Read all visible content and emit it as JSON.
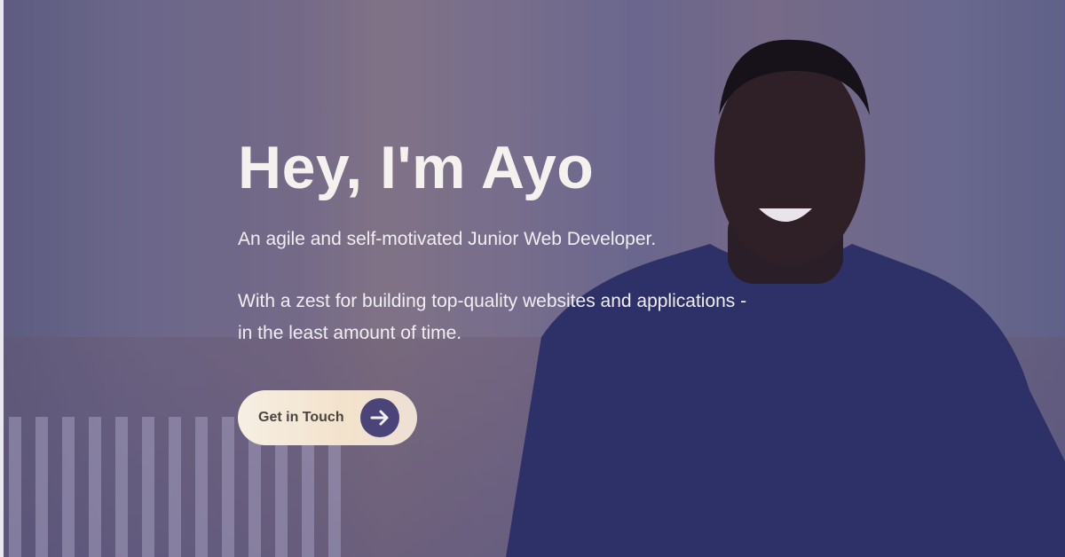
{
  "hero": {
    "title": "Hey, I'm Ayo",
    "subtitle": "An agile and self-motivated Junior Web Developer.",
    "description_line1": "With a zest for building top-quality websites and applications -",
    "description_line2": "in the least amount of time.",
    "cta_label": "Get in Touch",
    "cta_icon": "arrow-right-icon"
  },
  "colors": {
    "overlay": "#322d6e",
    "button_bg": "#f6efe3",
    "arrow_circle": "#4a4478",
    "shirt": "#2e3168"
  }
}
